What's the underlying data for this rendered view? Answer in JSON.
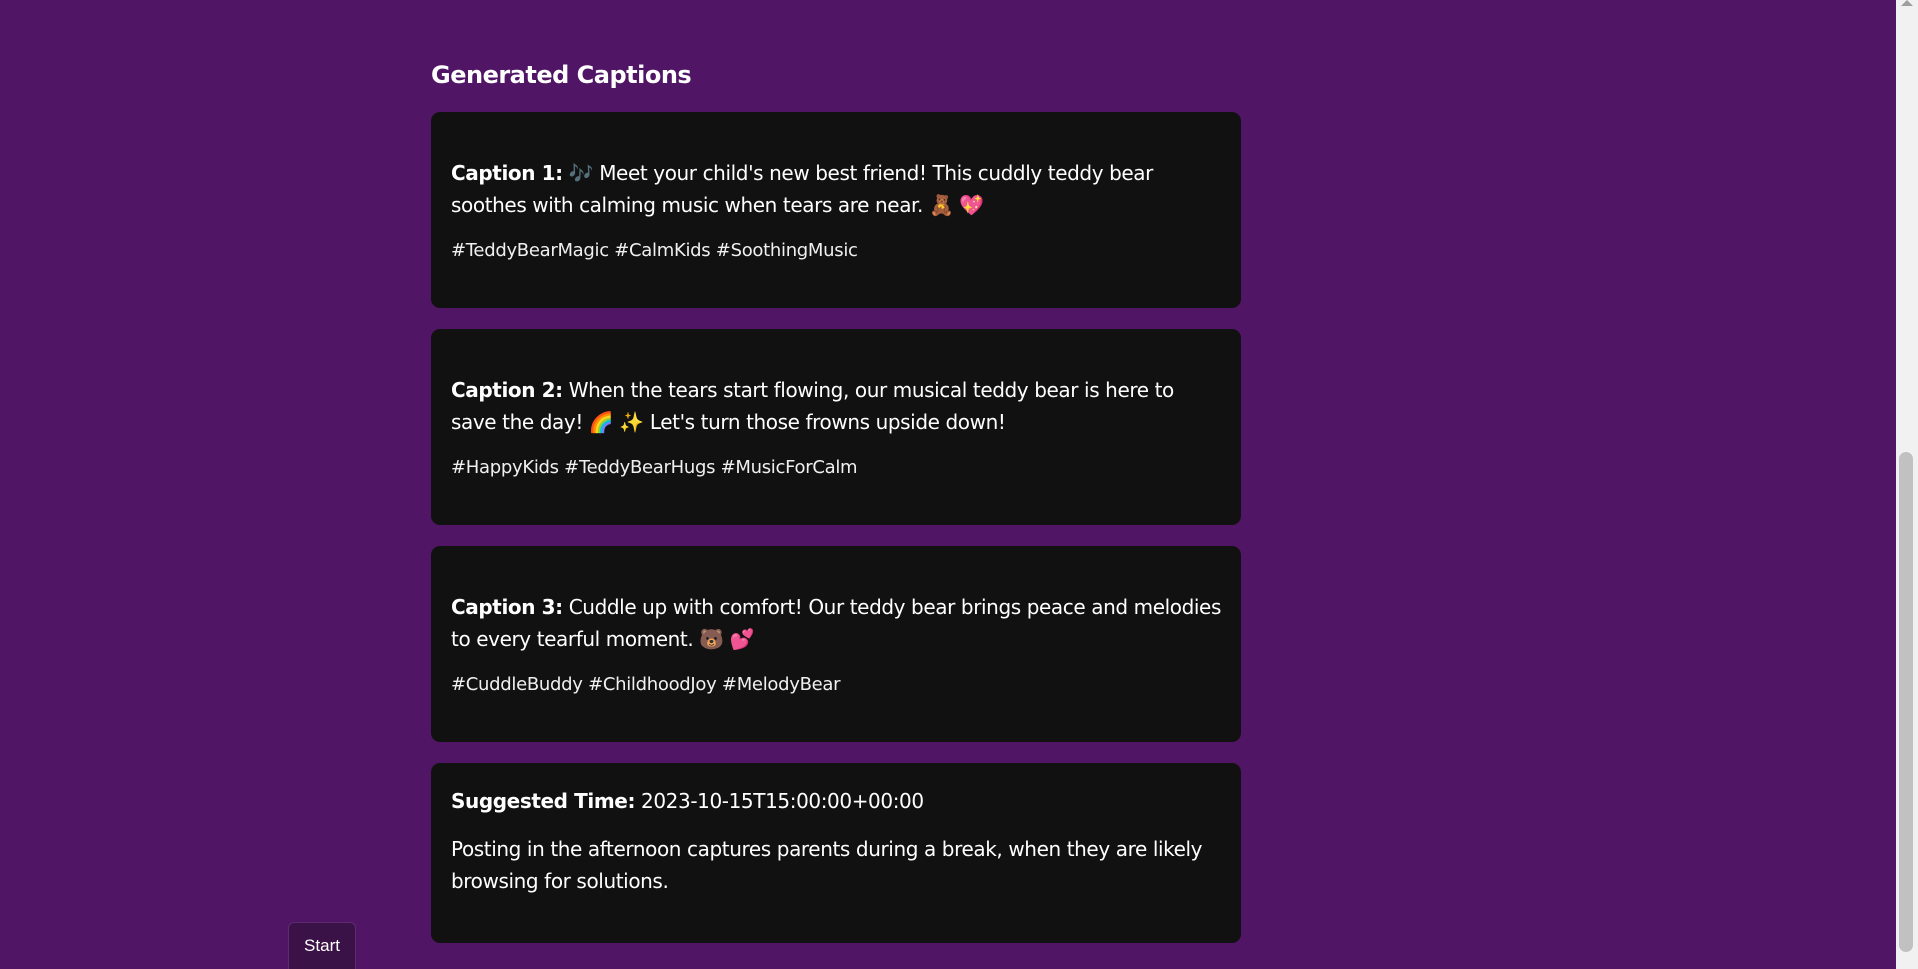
{
  "heading": "Generated Captions",
  "captions": [
    {
      "label": "Caption 1:",
      "text": "🎶 Meet your child's new best friend! This cuddly teddy bear soothes with calming music when tears are near. 🧸 💖",
      "hashtags": "#TeddyBearMagic #CalmKids #SoothingMusic"
    },
    {
      "label": "Caption 2:",
      "text": "When the tears start flowing, our musical teddy bear is here to save the day! 🌈 ✨ Let's turn those frowns upside down!",
      "hashtags": "#HappyKids #TeddyBearHugs #MusicForCalm"
    },
    {
      "label": "Caption 3:",
      "text": "Cuddle up with comfort! Our teddy bear brings peace and melodies to every tearful moment. 🐻 💕",
      "hashtags": "#CuddleBuddy #ChildhoodJoy #MelodyBear"
    }
  ],
  "suggested_time": {
    "label": "Suggested Time:",
    "value": "2023-10-15T15:00:00+00:00",
    "description": "Posting in the afternoon captures parents during a break, when they are likely browsing for solutions."
  },
  "start_button": {
    "label": "Start"
  },
  "colors": {
    "background": "#511566",
    "card": "#111111",
    "scrollbar_track": "#f1f1f1",
    "scrollbar_thumb": "#c1c1c1"
  }
}
